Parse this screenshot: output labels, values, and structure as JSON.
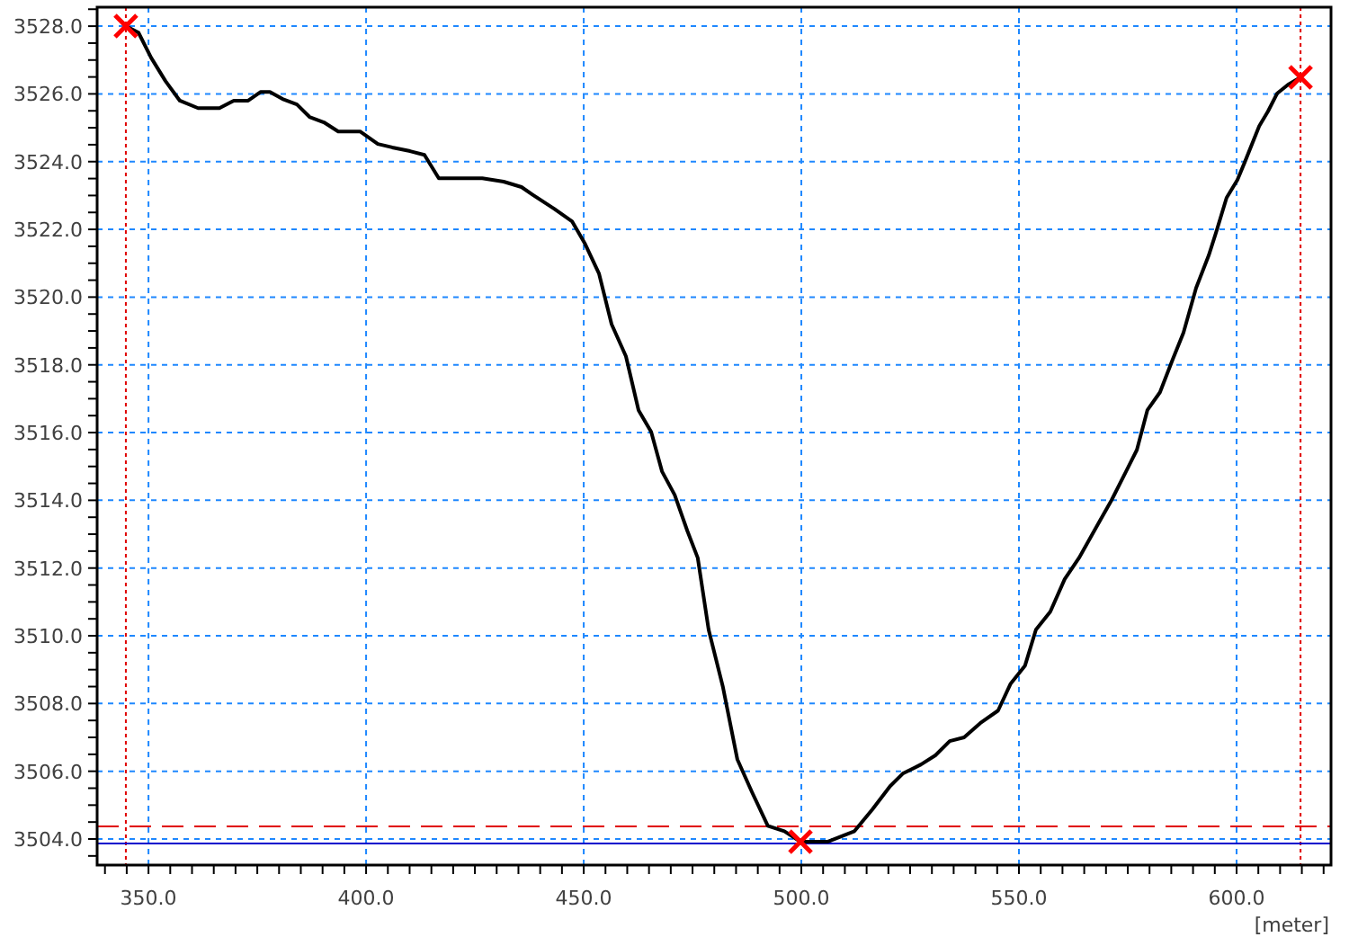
{
  "chart": {
    "chart_data": {
      "type": "line",
      "xlabel": "[meter]",
      "xlim": [
        338.2,
        621.7
      ],
      "ylim": [
        3503.23,
        3528.56
      ],
      "xticks": [
        {
          "value": 350,
          "label": "350.0"
        },
        {
          "value": 400,
          "label": "400.0"
        },
        {
          "value": 450,
          "label": "450.0"
        },
        {
          "value": 500,
          "label": "500.0"
        },
        {
          "value": 550,
          "label": "550.0"
        },
        {
          "value": 600,
          "label": "600.0"
        }
      ],
      "yticks": [
        {
          "value": 3504,
          "label": "3504.0"
        },
        {
          "value": 3506,
          "label": "3506.0"
        },
        {
          "value": 3508,
          "label": "3508.0"
        },
        {
          "value": 3510,
          "label": "3510.0"
        },
        {
          "value": 3512,
          "label": "3512.0"
        },
        {
          "value": 3514,
          "label": "3514.0"
        },
        {
          "value": 3516,
          "label": "3516.0"
        },
        {
          "value": 3518,
          "label": "3518.0"
        },
        {
          "value": 3520,
          "label": "3520.0"
        },
        {
          "value": 3522,
          "label": "3522.0"
        },
        {
          "value": 3524,
          "label": "3524.0"
        },
        {
          "value": 3526,
          "label": "3526.0"
        },
        {
          "value": 3528,
          "label": "3528.0"
        }
      ],
      "x": [
        344.8,
        347.7,
        350.6,
        353.9,
        357.2,
        361.4,
        366.3,
        369.6,
        372.9,
        375.8,
        377.9,
        380.8,
        384.1,
        387.0,
        390.3,
        393.6,
        398.6,
        402.7,
        406.0,
        410.1,
        413.4,
        416.7,
        426.7,
        431.6,
        435.7,
        438.2,
        443.2,
        447.3,
        450.2,
        453.5,
        456.4,
        459.7,
        462.6,
        465.5,
        468.0,
        470.9,
        473.8,
        476.2,
        478.7,
        482.0,
        485.3,
        488.6,
        492.3,
        496.1,
        499.8,
        506.0,
        512.2,
        516.3,
        520.4,
        523.3,
        527.5,
        530.8,
        534.1,
        537.4,
        541.1,
        545.2,
        548.1,
        551.4,
        553.9,
        557.2,
        560.5,
        563.8,
        568.0,
        571.3,
        574.6,
        577.1,
        579.5,
        582.4,
        585.3,
        587.8,
        590.7,
        593.6,
        595.2,
        597.7,
        600.2,
        601.9,
        605.2,
        607.2,
        609.3,
        611.8,
        614.7
      ],
      "series": [
        {
          "color": "#000000",
          "values": [
            3528.0,
            3527.81,
            3527.07,
            3526.38,
            3525.8,
            3525.58,
            3525.58,
            3525.8,
            3525.8,
            3526.06,
            3526.06,
            3525.85,
            3525.69,
            3525.32,
            3525.16,
            3524.89,
            3524.89,
            3524.52,
            3524.42,
            3524.31,
            3524.2,
            3523.51,
            3523.51,
            3523.41,
            3523.25,
            3523.03,
            3522.61,
            3522.24,
            3521.6,
            3520.7,
            3519.2,
            3518.25,
            3516.66,
            3516.02,
            3514.85,
            3514.16,
            3513.1,
            3512.3,
            3510.18,
            3508.48,
            3506.35,
            3505.4,
            3504.39,
            3504.23,
            3503.92,
            3503.92,
            3504.23,
            3504.87,
            3505.56,
            3505.93,
            3506.2,
            3506.47,
            3506.89,
            3507.0,
            3507.42,
            3507.79,
            3508.59,
            3509.12,
            3510.18,
            3510.71,
            3511.67,
            3512.3,
            3513.26,
            3514.01,
            3514.85,
            3515.49,
            3516.66,
            3517.19,
            3518.15,
            3518.95,
            3520.27,
            3521.23,
            3521.87,
            3522.93,
            3523.46,
            3523.99,
            3525.05,
            3525.48,
            3526.01,
            3526.27,
            3526.49
          ]
        }
      ],
      "grid": true,
      "ref_lines": [
        {
          "axis": "x",
          "value": 344.8,
          "color": "#e00000"
        },
        {
          "axis": "x",
          "value": 614.7,
          "color": "#e00000"
        },
        {
          "axis": "y",
          "value": 3504.37,
          "color": "#e00000"
        },
        {
          "axis": "y",
          "value": 3503.87,
          "color": "#0000cc"
        }
      ]
    }
  }
}
